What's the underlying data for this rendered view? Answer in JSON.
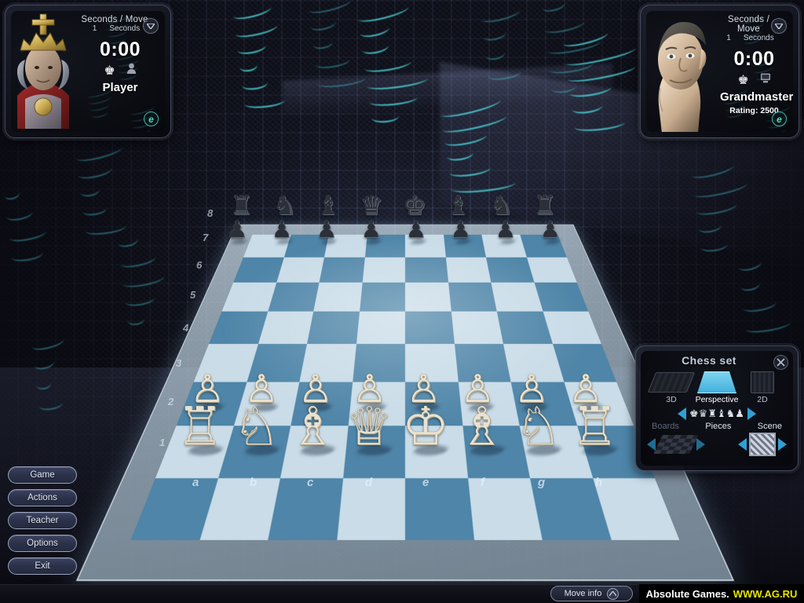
{
  "window": {
    "title": "Chess"
  },
  "players": {
    "left": {
      "mode_label": "Seconds / Move",
      "mode_value": "1",
      "mode_unit": "Seconds",
      "clock": "0:00",
      "side_icon": "black-king-icon",
      "controller_icon": "human-player-icon",
      "name": "Player",
      "rating": "",
      "badge": "e",
      "collapse_icon": "chevron-down-icon"
    },
    "right": {
      "mode_label": "Seconds / Move",
      "mode_value": "1",
      "mode_unit": "Seconds",
      "clock": "0:00",
      "side_icon": "white-king-icon",
      "controller_icon": "computer-player-icon",
      "name": "Grandmaster",
      "rating": "Rating: 2500",
      "badge": "e",
      "collapse_icon": "chevron-down-icon"
    }
  },
  "board": {
    "files": [
      "a",
      "b",
      "c",
      "d",
      "e",
      "f",
      "g",
      "h"
    ],
    "ranks": [
      "8",
      "7",
      "6",
      "5",
      "4",
      "3",
      "2",
      "1"
    ],
    "light_square_color": "#c9dce8",
    "dark_square_color": "#4e85a8",
    "position": [
      [
        "br",
        "bn",
        "bb",
        "bq",
        "bk",
        "bb",
        "bn",
        "br"
      ],
      [
        "bp",
        "bp",
        "bp",
        "bp",
        "bp",
        "bp",
        "bp",
        "bp"
      ],
      [
        "",
        "",
        "",
        "",
        "",
        "",
        "",
        ""
      ],
      [
        "",
        "",
        "",
        "",
        "",
        "",
        "",
        ""
      ],
      [
        "",
        "",
        "",
        "",
        "",
        "",
        "",
        ""
      ],
      [
        "",
        "",
        "",
        "",
        "",
        "",
        "",
        ""
      ],
      [
        "wp",
        "wp",
        "wp",
        "wp",
        "wp",
        "wp",
        "wp",
        "wp"
      ],
      [
        "wr",
        "wn",
        "wb",
        "wq",
        "wk",
        "wb",
        "wn",
        "wr"
      ]
    ],
    "glyphs": {
      "wk": "♔",
      "wq": "♕",
      "wr": "♖",
      "wb": "♗",
      "wn": "♘",
      "wp": "♙",
      "bk": "♚",
      "bq": "♛",
      "br": "♜",
      "bb": "♝",
      "bn": "♞",
      "bp": "♟"
    }
  },
  "menu": {
    "items": [
      {
        "label": "Game",
        "name": "game"
      },
      {
        "label": "Actions",
        "name": "actions"
      },
      {
        "label": "Teacher",
        "name": "teacher"
      },
      {
        "label": "Options",
        "name": "options"
      },
      {
        "label": "Exit",
        "name": "exit"
      }
    ]
  },
  "chess_set": {
    "title": "Chess set",
    "close_icon": "close-icon",
    "views": [
      {
        "label": "3D",
        "selected": false
      },
      {
        "label": "Perspective",
        "selected": true
      },
      {
        "label": "2D",
        "selected": false
      }
    ],
    "pieces_preview": "♚♛♜♝♞♟",
    "labels": {
      "boards": "Boards",
      "pieces": "Pieces",
      "scene": "Scene"
    },
    "accent_color": "#2f9fd4"
  },
  "bottom_bar": {
    "move_info_label": "Move info",
    "move_info_icon": "chevron-up-icon",
    "watermark_primary": "Absolute Games.",
    "watermark_secondary": "WWW.AG.RU"
  }
}
